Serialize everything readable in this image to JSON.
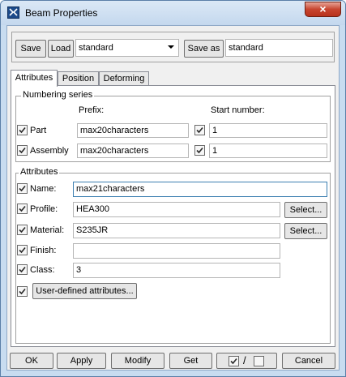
{
  "window": {
    "title": "Beam Properties",
    "close_glyph": "×"
  },
  "top_bar": {
    "save_label": "Save",
    "load_label": "Load",
    "load_value": "standard",
    "save_as_label": "Save as",
    "save_as_value": "standard"
  },
  "tabs": [
    {
      "label": "Attributes",
      "active": true
    },
    {
      "label": "Position",
      "active": false
    },
    {
      "label": "Deforming",
      "active": false
    }
  ],
  "numbering": {
    "group_label": "Numbering series",
    "prefix_header": "Prefix:",
    "start_header": "Start number:",
    "part": {
      "label": "Part",
      "prefix": "max20characters",
      "start": "1",
      "checked": true,
      "start_checked": true
    },
    "assembly": {
      "label": "Assembly",
      "prefix": "max20characters",
      "start": "1",
      "checked": true,
      "start_checked": true
    }
  },
  "attributes": {
    "group_label": "Attributes",
    "name": {
      "label": "Name:",
      "value": "max21characters",
      "checked": true
    },
    "profile": {
      "label": "Profile:",
      "value": "HEA300",
      "checked": true,
      "select_label": "Select..."
    },
    "material": {
      "label": "Material:",
      "value": "S235JR",
      "checked": true,
      "select_label": "Select..."
    },
    "finish": {
      "label": "Finish:",
      "value": "",
      "checked": true
    },
    "class": {
      "label": "Class:",
      "value": "3",
      "checked": true
    },
    "user_defined": {
      "label": "User-defined attributes...",
      "checked": true
    }
  },
  "bottom": {
    "ok_label": "OK",
    "apply_label": "Apply",
    "modify_label": "Modify",
    "get_label": "Get",
    "toggle_separator": "/",
    "cancel_label": "Cancel"
  },
  "colors": {
    "title_bar": "#c4d8ee",
    "close_button": "#c7452f",
    "focus_border": "#3c7fb1"
  }
}
